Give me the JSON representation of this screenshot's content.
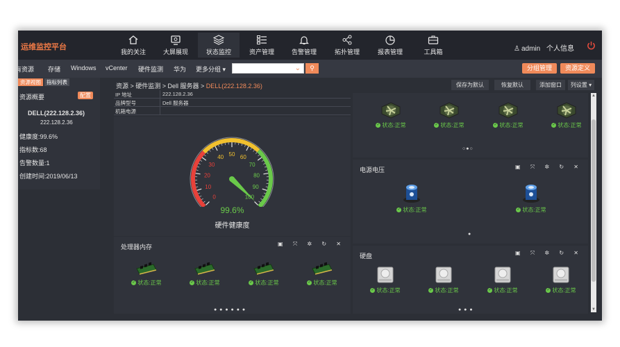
{
  "app": {
    "title": "运维监控平台"
  },
  "nav": [
    {
      "label": "我的关注",
      "icon": "home-icon"
    },
    {
      "label": "大屏展现",
      "icon": "screen-icon"
    },
    {
      "label": "状态监控",
      "icon": "layers-icon",
      "active": true
    },
    {
      "label": "资产管理",
      "icon": "list-icon"
    },
    {
      "label": "告警管理",
      "icon": "bell-icon"
    },
    {
      "label": "拓扑管理",
      "icon": "topology-icon"
    },
    {
      "label": "报表管理",
      "icon": "pie-chart-icon"
    },
    {
      "label": "工具箱",
      "icon": "toolbox-icon"
    }
  ],
  "user": {
    "name": "admin",
    "profile": "个人信息"
  },
  "subnav": [
    "有资源",
    "存储",
    "Windows",
    "vCenter",
    "硬件监测",
    "华为",
    "更多分组 ▾"
  ],
  "buttons": {
    "group_manage": "分组管理",
    "resource_define": "资源定义",
    "save_default": "保存为默认",
    "restore_default": "恢复默认",
    "add_window": "添加窗口",
    "column_settings": "列设置 ▾"
  },
  "left_panel": {
    "tab1": "资源视图",
    "tab2": "指标列表",
    "title": "资源概要",
    "config": "配置",
    "device": "DELL(222.128.2.36)",
    "ip": "222.128.2.36",
    "health": "健康度:99.6%",
    "metrics": "指标数:68",
    "alarms": "告警数量:1",
    "created": "创建时间:2019/06/13"
  },
  "breadcrumb": {
    "path": "资源 > 硬件监测 > Dell 服务器 > ",
    "current": "DELL(222.128.2.36)"
  },
  "info_table": [
    {
      "key": "IP 地址",
      "value": "222.128.2.36"
    },
    {
      "key": "品牌型号",
      "value": "Dell 服务器"
    },
    {
      "key": "机箱电源",
      "value": ""
    }
  ],
  "gauge": {
    "value": 99.6,
    "value_text": "99.6%",
    "title": "硬件健康度",
    "ticks": [
      "0",
      "10",
      "20",
      "30",
      "40",
      "50",
      "60",
      "70",
      "80",
      "90",
      "100"
    ]
  },
  "panels": {
    "fans": {
      "status": "状态:正常",
      "count": 4,
      "pages": "○●○"
    },
    "power": {
      "title": "电源电压",
      "status": "状态:正常",
      "count": 2,
      "pages": "●"
    },
    "memory": {
      "title": "处理器内存",
      "status": "状态:正常",
      "count": 4,
      "pages": "● ● ● ● ● ●"
    },
    "disk": {
      "title": "硬盘",
      "status": "状态:正常",
      "count": 4,
      "pages": "● ● ●"
    }
  },
  "panel_controls": "▣ ⤧ ✲ ↻ ✕",
  "colors": {
    "accent": "#f08a5a",
    "ok": "#6ac94a",
    "bg": "#2c2f36"
  }
}
